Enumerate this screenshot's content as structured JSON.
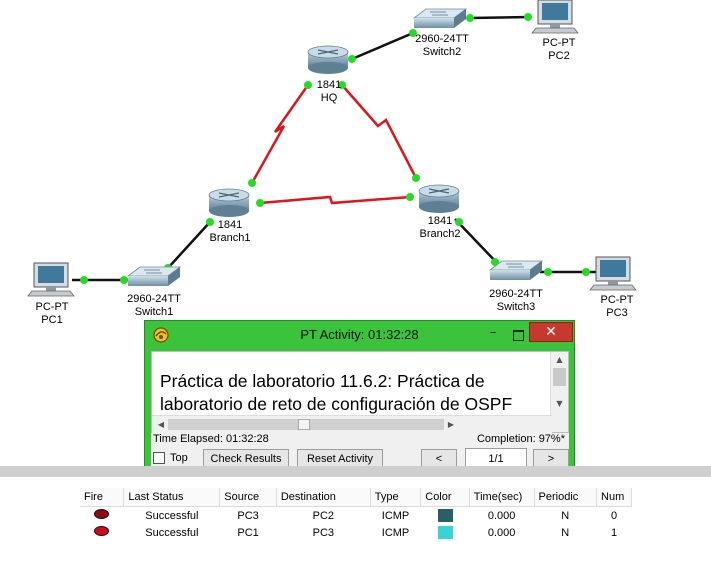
{
  "devices": {
    "hq": {
      "model": "1841",
      "name": "HQ"
    },
    "branch1": {
      "model": "1841",
      "name": "Branch1"
    },
    "branch2": {
      "model": "1841",
      "name": "Branch2"
    },
    "switch1": {
      "model": "2960-24TT",
      "name": "Switch1"
    },
    "switch2": {
      "model": "2960-24TT",
      "name": "Switch2"
    },
    "switch3": {
      "model": "2960-24TT",
      "name": "Switch3"
    },
    "pc1": {
      "model": "PC-PT",
      "name": "PC1"
    },
    "pc2": {
      "model": "PC-PT",
      "name": "PC2"
    },
    "pc3": {
      "model": "PC-PT",
      "name": "PC3"
    }
  },
  "colors": {
    "serial_link": "#e0141b",
    "ethernet_link": "#111111",
    "link_up": "#22dd22",
    "window_green": "#3bc43b",
    "close_red": "#c7392e"
  },
  "activity": {
    "title": "PT Activity: 01:32:28",
    "description_line1": "Práctica de laboratorio 11.6.2: Práctica de",
    "description_line2": "laboratorio de reto de configuración de OSPF",
    "time_elapsed": "Time Elapsed: 01:32:28",
    "completion": "Completion: 97%*",
    "top_label": "Top",
    "check_results": "Check Results",
    "reset_activity": "Reset Activity",
    "prev": "<",
    "page": "1/1",
    "next": ">",
    "minimize": "–",
    "close": "✕"
  },
  "pdu_table": {
    "headers": [
      "Fire",
      "Last Status",
      "Source",
      "Destination",
      "Type",
      "Color",
      "Time(sec)",
      "Periodic",
      "Num"
    ],
    "rows": [
      {
        "status": "Successful",
        "source": "PC3",
        "destination": "PC2",
        "type": "ICMP",
        "color": "#2b5e68",
        "time": "0.000",
        "periodic": "N",
        "num": "0"
      },
      {
        "status": "Successful",
        "source": "PC1",
        "destination": "PC3",
        "type": "ICMP",
        "color": "#37d3d6",
        "time": "0.000",
        "periodic": "N",
        "num": "1"
      }
    ]
  }
}
